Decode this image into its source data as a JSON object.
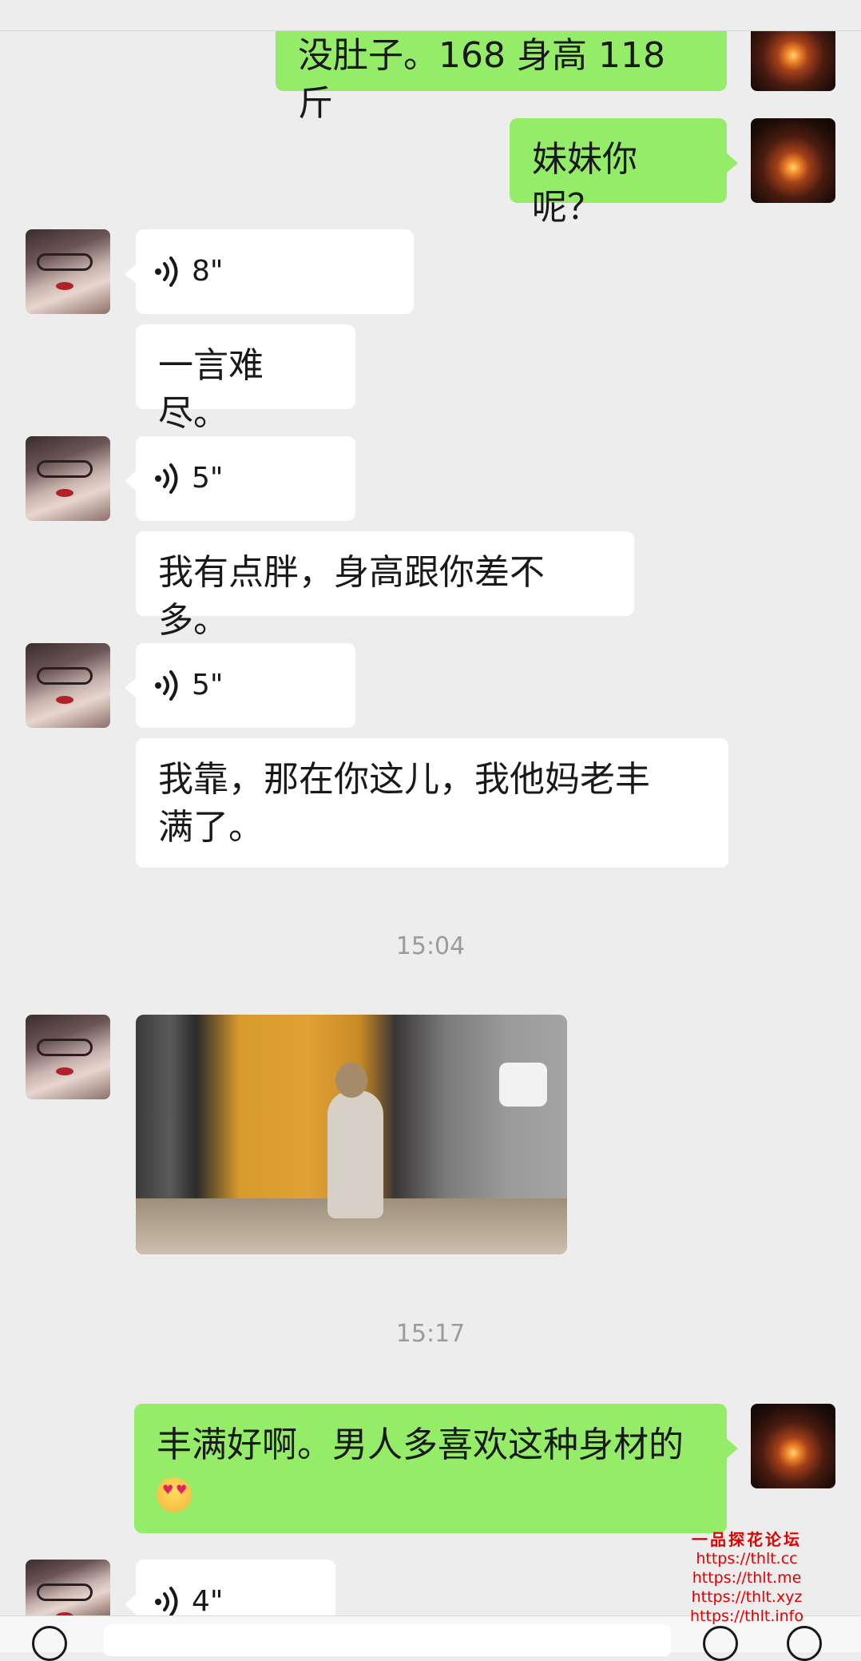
{
  "messages": {
    "m1": "没肚子。168 身高 118 斤",
    "m2": "妹妹你呢？",
    "v1": "8\"",
    "m3": "一言难尽。",
    "v2": "5\"",
    "m4": "我有点胖，身高跟你差不多。",
    "v3": "5\"",
    "m5": "我靠，那在你这儿，我他妈老丰满了。",
    "m6": "丰满好啊。男人多喜欢这种身材的",
    "v4": "4\""
  },
  "timestamps": {
    "t1": "15:04",
    "t2": "15:17"
  },
  "watermark": {
    "title": "一品探花论坛",
    "links": [
      "https://thlt.cc",
      "https://thlt.me",
      "https://thlt.xyz",
      "https://thlt.info"
    ]
  },
  "icons": {
    "voice": "voice-wave-icon",
    "emoji": "heart-eyes-emoji-icon"
  },
  "colors": {
    "background": "#ededed",
    "sent_bubble": "#95ec69",
    "received_bubble": "#ffffff",
    "timestamp": "#9b9b9b",
    "watermark": "#e30000"
  }
}
